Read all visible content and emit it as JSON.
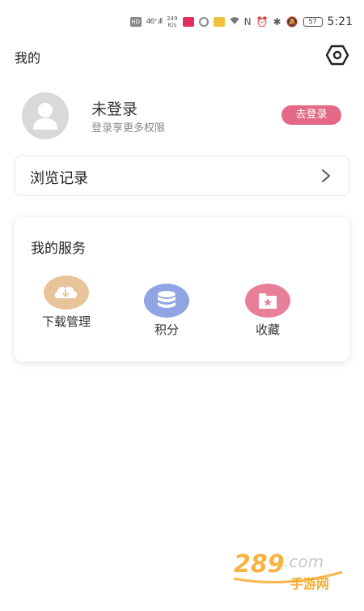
{
  "status_bar": {
    "hd": "HD",
    "signal": "46⁺.ıll",
    "speed_value": "249",
    "speed_unit": "K/s",
    "nfc": "N",
    "alarm": "⏰",
    "bluetooth": "✱",
    "mute": "🔕",
    "battery": "57",
    "time": "5:21"
  },
  "header": {
    "title": "我的"
  },
  "profile": {
    "name": "未登录",
    "subtitle": "登录享更多权限",
    "login_button": "去登录"
  },
  "history": {
    "label": "浏览记录",
    "chevron": "chevron-right-icon"
  },
  "services": {
    "title": "我的服务",
    "items": [
      {
        "label": "下载管理",
        "icon": "cloud-download-icon",
        "color": "#e9c49b"
      },
      {
        "label": "积分",
        "icon": "coin-stack-icon",
        "color": "#8fa4e2"
      },
      {
        "label": "收藏",
        "icon": "star-folder-icon",
        "color": "#e87f99"
      }
    ]
  },
  "watermark": {
    "digits": "289",
    "suffix": ".com",
    "cn": "手游网"
  },
  "colors": {
    "accent": "#e36a86",
    "card_border": "#e6e6e6"
  }
}
